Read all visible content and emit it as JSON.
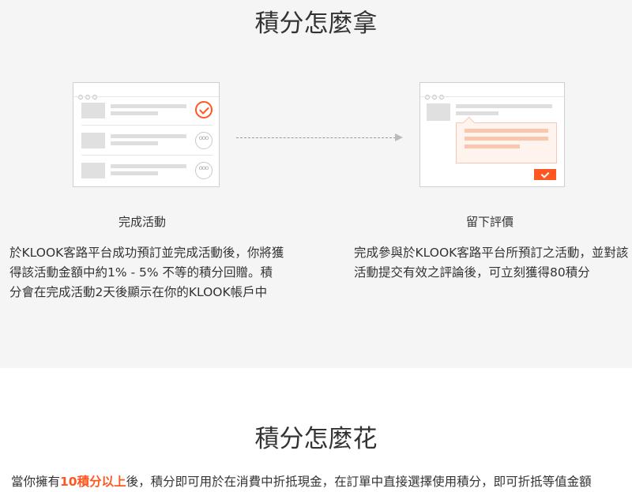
{
  "earn": {
    "title": "積分怎麼拿",
    "step1": {
      "title": "完成活動",
      "desc": "於KLOOK客路平台成功預訂並完成活動後，你將獲得該活動金額中約1% - 5% 不等的積分回贈。積分會在完成活動2天後顯示在你的KLOOK帳戶中"
    },
    "step2": {
      "title": "留下評價",
      "desc": "完成參與於KLOOK客路平台所預訂之活動，並對該活動提交有效之評論後，可立刻獲得80積分"
    }
  },
  "spend": {
    "title": "積分怎麼花",
    "text_before": "當你擁有",
    "highlight": "10積分以上",
    "text_after": "後，積分即可用於在消費中折抵現金，在訂單中直接選擇使用積分，即可折抵等值金額"
  },
  "colors": {
    "accent": "#ff5722",
    "section_bg": "#f5f5f5"
  },
  "icons": [
    "check-circle-icon",
    "more-circle-icon",
    "arrow-right-icon",
    "check-button-icon"
  ]
}
